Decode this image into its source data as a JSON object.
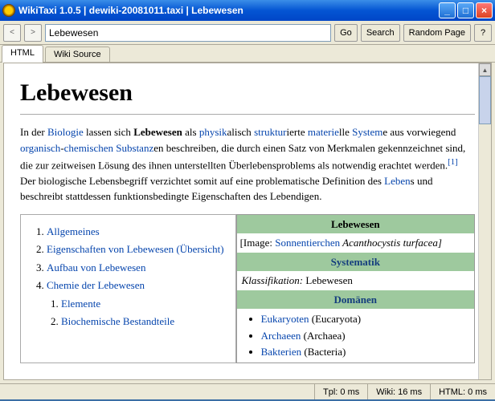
{
  "window": {
    "title": "WikiTaxi 1.0.5 | dewiki-20081011.taxi | Lebewesen"
  },
  "toolbar": {
    "search_value": "Lebewesen",
    "go": "Go",
    "search": "Search",
    "random": "Random Page",
    "help": "?"
  },
  "tabs": {
    "html": "HTML",
    "wikisource": "Wiki Source"
  },
  "article": {
    "title": "Lebewesen",
    "p1_prefix": "In der ",
    "p1_biologie": "Biologie",
    "p1_t1": " lassen sich ",
    "p1_bold": "Lebewesen",
    "p1_t2": " als ",
    "p1_physik": "physik",
    "p1_t3": "alisch ",
    "p1_struktur": "struktur",
    "p1_t4": "ierte ",
    "p1_materie": "materie",
    "p1_t5": "lle ",
    "p1_systeme": "System",
    "p1_t6": "e aus vorwiegend ",
    "p1_organisch": "organisch",
    "p1_t7": "-",
    "p1_chemischen": "chemischen",
    "p1_t8": " ",
    "p1_substanz": "Substanz",
    "p1_t9": "en beschreiben, die durch einen Satz von Merkmalen gekennzeichnet sind, die zur zeitweisen Lösung des ihnen unterstellten Überlebensproblems als notwendig erachtet werden.",
    "p1_ref": "[1]",
    "p1_t10": " Der biologische Lebensbegriff verzichtet somit auf eine problematische Definition des ",
    "p1_lebens": "Leben",
    "p1_t11": "s und beschreibt stattdessen funktionsbedingte Eigenschaften des Lebendigen.",
    "toc": {
      "i1": "Allgemeines",
      "i2": "Eigenschaften von Lebewesen (Übersicht)",
      "i3": "Aufbau von Lebewesen",
      "i4": "Chemie der Lebewesen",
      "i4_1": "Elemente",
      "i4_2": "Biochemische Bestandteile"
    },
    "infobox": {
      "h1": "Lebewesen",
      "img_prefix": "[Image: ",
      "img_link": "Sonnentierchen",
      "img_suffix": " Acanthocystis turfacea]",
      "h2": "Systematik",
      "klass_label": "Klassifikation:",
      "klass_value": " Lebewesen",
      "h3": "Domänen",
      "d1": "Eukaryoten",
      "d1p": " (Eucaryota)",
      "d2": "Archaeen",
      "d2p": " (Archaea)",
      "d3": "Bakterien",
      "d3p": " (Bacteria)"
    }
  },
  "status": {
    "tpl": "Tpl: 0 ms",
    "wiki": "Wiki: 16 ms",
    "html": "HTML: 0 ms"
  }
}
